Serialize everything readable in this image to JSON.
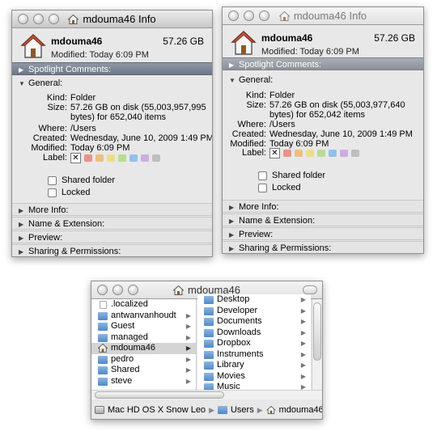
{
  "info_left": {
    "window_title": "mdouma46 Info",
    "name": "mdouma46",
    "size": "57.26 GB",
    "modified_line": "Modified: Today 6:09 PM",
    "spotlight_label": "Spotlight Comments:",
    "general_label": "General:",
    "general": {
      "kind_label": "Kind:",
      "kind": "Folder",
      "size_label": "Size:",
      "size_line1": "57.26 GB on disk (55,003,957,995",
      "size_line2": "bytes) for 652,040 items",
      "where_label": "Where:",
      "where": "/Users",
      "created_label": "Created:",
      "created": "Wednesday, June 10, 2009 1:49 PM",
      "modified_label": "Modified:",
      "modified": "Today 6:09 PM",
      "label_label": "Label:",
      "shared_folder": "Shared folder",
      "locked": "Locked"
    },
    "more_info": "More Info:",
    "name_ext": "Name & Extension:",
    "preview": "Preview:",
    "sharing": "Sharing & Permissions:"
  },
  "info_right": {
    "window_title": "mdouma46 Info",
    "name": "mdouma46",
    "size": "57.26 GB",
    "modified_line": "Modified: Today 6:09 PM",
    "spotlight_label": "Spotlight Comments:",
    "general_label": "General:",
    "general": {
      "kind_label": "Kind:",
      "kind": "Folder",
      "size_label": "Size:",
      "size_line1": "57.26 GB on disk (55,003,977,640",
      "size_line2": "bytes) for 652,042 items",
      "where_label": "Where:",
      "where": "/Users",
      "created_label": "Created:",
      "created": "Wednesday, June 10, 2009 1:49 PM",
      "modified_label": "Modified:",
      "modified": "Today 6:09 PM",
      "label_label": "Label:",
      "shared_folder": "Shared folder",
      "locked": "Locked"
    },
    "more_info": "More Info:",
    "name_ext": "Name & Extension:",
    "preview": "Preview:",
    "sharing": "Sharing & Permissions:"
  },
  "label_colors": [
    "#e94a3a",
    "#f29a30",
    "#f0d43a",
    "#8fd14f",
    "#4c9df0",
    "#b57bd8",
    "#9a9a9a"
  ],
  "finder": {
    "window_title": "mdouma46",
    "users_column": [
      ".localized",
      "antwanvanhoudt",
      "Guest",
      "managed",
      "mdouma46",
      "pedro",
      "Shared",
      "steve"
    ],
    "home_column": [
      "Desktop",
      "Developer",
      "Documents",
      "Downloads",
      "Dropbox",
      "Instruments",
      "Library",
      "Movies",
      "Music"
    ],
    "path": {
      "disk": "Mac HD OS X Snow Leo",
      "users": "Users",
      "home": "mdouma46"
    }
  }
}
